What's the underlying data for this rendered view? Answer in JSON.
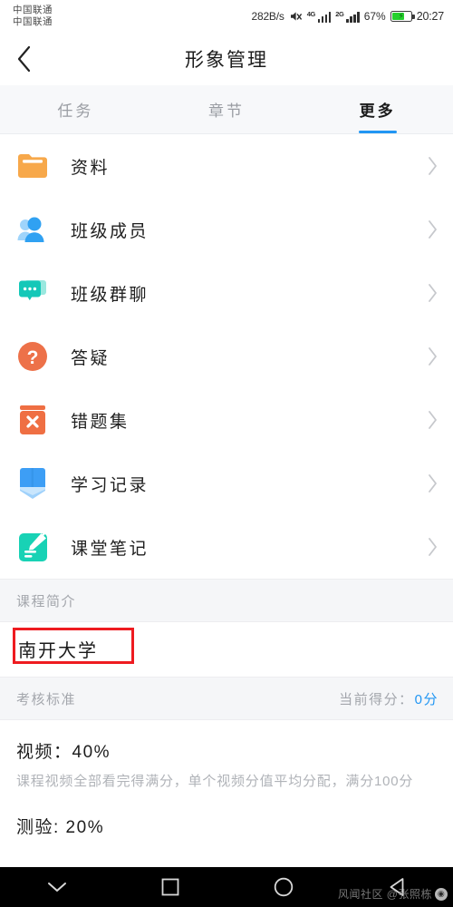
{
  "status_bar": {
    "carrier_line1": "中国联通",
    "carrier_line2": "中国联通",
    "net_speed": "282B/s",
    "mute_icon": "mute-icon",
    "signal_1_label": "4G",
    "signal_2_label": "2G",
    "battery_percent": "67%",
    "battery_level": 67,
    "clock": "20:27"
  },
  "header": {
    "back_icon": "chevron-left-icon",
    "title": "形象管理"
  },
  "tabs": [
    {
      "label": "任务",
      "active": false
    },
    {
      "label": "章节",
      "active": false
    },
    {
      "label": "更多",
      "active": true
    }
  ],
  "menu": {
    "items": [
      {
        "label": "资料",
        "icon": "folder-icon",
        "color": "#f7a84a"
      },
      {
        "label": "班级成员",
        "icon": "people-icon",
        "color": "#30a1f2"
      },
      {
        "label": "班级群聊",
        "icon": "chat-bubble-icon",
        "color": "#14c8b8"
      },
      {
        "label": "答疑",
        "icon": "question-mark-icon",
        "color": "#ed7149"
      },
      {
        "label": "错题集",
        "icon": "error-book-icon",
        "color": "#ef6f43"
      },
      {
        "label": "学习记录",
        "icon": "study-book-icon",
        "color": "#3d9ef5"
      },
      {
        "label": "课堂笔记",
        "icon": "note-pencil-icon",
        "color": "#18d2b5"
      }
    ],
    "chevron_icon": "chevron-right-icon"
  },
  "course_intro": {
    "section_title": "课程简介",
    "university": "南开大学",
    "highlight_color": "#ee1b20"
  },
  "criteria": {
    "section_title": "考核标准",
    "score_label": "当前得分：",
    "score_value": "0分",
    "score_color": "#2196f3",
    "items": [
      {
        "title": "视频：40%",
        "desc": "课程视频全部看完得满分，单个视频分值平均分配，满分100分"
      },
      {
        "title": "测验: 20%",
        "desc": ""
      }
    ]
  },
  "nav_bar": {
    "buttons": [
      {
        "icon": "chevron-down-icon",
        "name": "hide-navbar-button"
      },
      {
        "icon": "square-icon",
        "name": "recent-apps-button"
      },
      {
        "icon": "circle-icon",
        "name": "home-button"
      },
      {
        "icon": "triangle-left-icon",
        "name": "back-button"
      }
    ],
    "watermark_text": "风闻社区 @张照栋",
    "watermark_icon": "weibo-icon"
  }
}
